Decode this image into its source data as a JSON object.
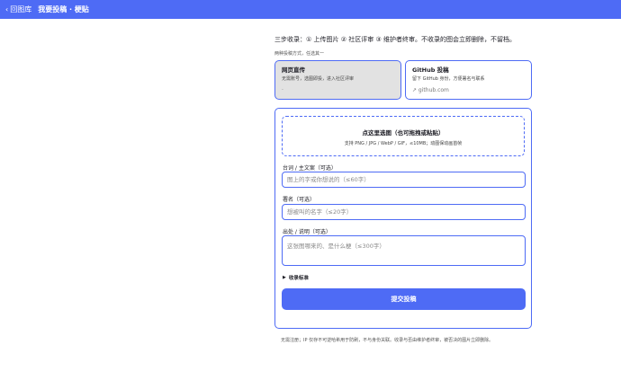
{
  "topbar": {
    "back_label": "回图库",
    "title": "我要投稿 · 梗贴"
  },
  "intro": {
    "steps": "三步收录：① 上传图片 ② 社区评审 ③ 维护者终审。不收录的图会立即删除，不留档。",
    "methods_label": "两种投稿方式，任选其一"
  },
  "methods": {
    "web": {
      "title": "网页直传",
      "desc": "无需账号，选图即投，进入社区评审",
      "extra": "·"
    },
    "github": {
      "title": "GitHub 投稿",
      "desc": "留下 GitHub 身份，方便署名与联系",
      "link": "↗ github.com"
    }
  },
  "form": {
    "drop": {
      "title": "点这里选图（也可拖拽或粘贴）",
      "desc": "支持 PNG / JPG / WebP / GIF，≤10MB；动图保动画首帧"
    },
    "caption": {
      "label": "台词 / 主文案（可选）",
      "placeholder": "图上的字或你想说的（≤60字）"
    },
    "author": {
      "label": "署名（可选）",
      "placeholder": "想被叫的名字（≤20字）"
    },
    "source": {
      "label": "出处 / 说明（可选）",
      "placeholder": "这张图哪来的、是什么梗（≤300字）"
    },
    "advanced_label": "收录标准",
    "submit_label": "提交投稿"
  },
  "footer": {
    "note": "无需注册；IP 仅存不可逆哈希用于防刷，不与身份关联。收录与否由维护者终审，被否决的图片立即删除。"
  },
  "colors": {
    "accent": "#4e6bf5",
    "selected_bg": "#e2e2e2"
  }
}
